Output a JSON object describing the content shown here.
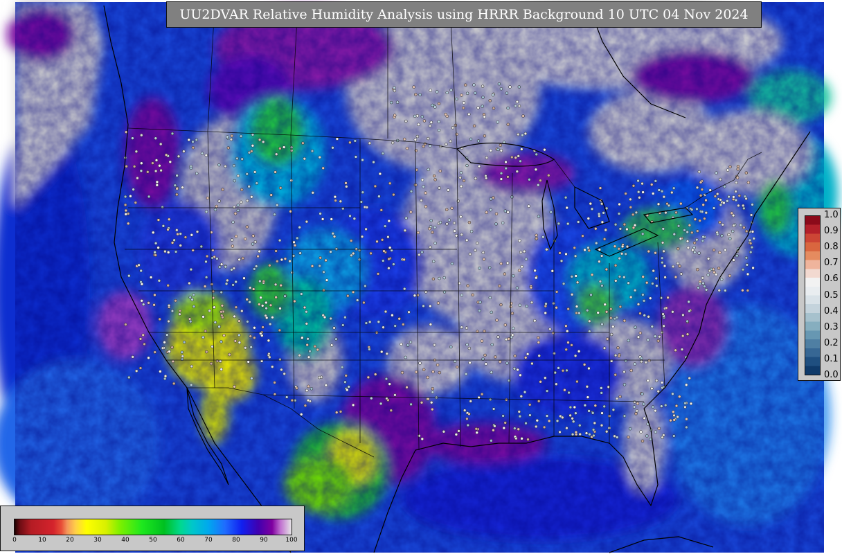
{
  "title": "UU2DVAR Relative Humidity Analysis using HRRR Background 10 UTC 04 Nov 2024",
  "right_colorbar": {
    "ticks": [
      "1.0",
      "0.9",
      "0.8",
      "0.7",
      "0.6",
      "0.5",
      "0.4",
      "0.3",
      "0.2",
      "0.1",
      "0.0"
    ],
    "colors_top_to_bottom": [
      "#8b0a1a",
      "#b3202a",
      "#cc4535",
      "#d9663f",
      "#e58b5f",
      "#efb49c",
      "#f2d9d0",
      "#f2f2f2",
      "#e9edf0",
      "#d9e2e8",
      "#c4d3dc",
      "#a6c1cd",
      "#86aebf",
      "#6797b2",
      "#4f7fa3",
      "#376794",
      "#1f4f80",
      "#0f3a6a"
    ]
  },
  "bottom_colorbar": {
    "ticks": [
      "0",
      "10",
      "20",
      "30",
      "40",
      "50",
      "60",
      "70",
      "80",
      "90",
      "100"
    ],
    "stops": [
      {
        "value": 0,
        "color": "#1a0000"
      },
      {
        "value": 2,
        "color": "#6e0d14"
      },
      {
        "value": 6,
        "color": "#b51c24"
      },
      {
        "value": 14,
        "color": "#d4232c"
      },
      {
        "value": 17,
        "color": "#e85038"
      },
      {
        "value": 19,
        "color": "#f4955a"
      },
      {
        "value": 22,
        "color": "#ffcf48"
      },
      {
        "value": 26,
        "color": "#ffff00"
      },
      {
        "value": 33,
        "color": "#d8f000"
      },
      {
        "value": 38,
        "color": "#7ef000"
      },
      {
        "value": 46,
        "color": "#1ee81e"
      },
      {
        "value": 54,
        "color": "#00c020"
      },
      {
        "value": 60,
        "color": "#00d890"
      },
      {
        "value": 64,
        "color": "#00c8c8"
      },
      {
        "value": 70,
        "color": "#00a8ee"
      },
      {
        "value": 76,
        "color": "#1f6cff"
      },
      {
        "value": 82,
        "color": "#1020f0"
      },
      {
        "value": 88,
        "color": "#4000b0"
      },
      {
        "value": 93,
        "color": "#7f00a0"
      },
      {
        "value": 96,
        "color": "#c070d0"
      },
      {
        "value": 100,
        "color": "#e6e6e6"
      }
    ]
  },
  "colors": {
    "ocean_humid": "#1a4bdd",
    "saturated": "#cfcfcf",
    "very_humid": "#7a0fa0",
    "moderate": "#00b8e0",
    "dry": "#e8ef00",
    "land_outline": "#000000"
  }
}
